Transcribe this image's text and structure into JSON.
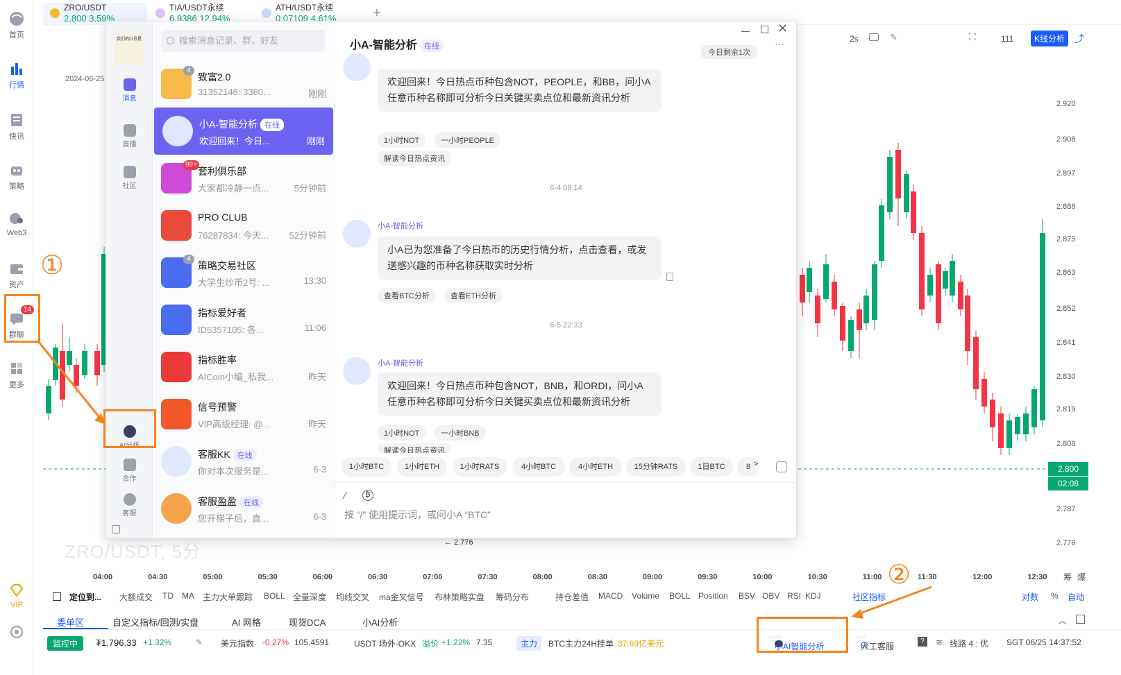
{
  "left_nav": {
    "items": [
      {
        "label": "首页",
        "icon": "globe-icon"
      },
      {
        "label": "行情",
        "icon": "bar-chart-icon"
      },
      {
        "label": "快讯",
        "icon": "news-icon"
      },
      {
        "label": "策略",
        "icon": "robot-icon"
      },
      {
        "label": "Web3",
        "icon": "web3-icon"
      },
      {
        "label": "资产",
        "icon": "wallet-icon"
      },
      {
        "label": "群聊",
        "icon": "chat-icon",
        "badge": "14"
      },
      {
        "label": "更多",
        "icon": "grid-icon"
      },
      {
        "label": "VIP",
        "icon": "vip-diamond-icon"
      }
    ]
  },
  "tabs": [
    {
      "name": "ZRO/USDT",
      "price": "2.800",
      "change": "3.59%"
    },
    {
      "name": "TIA/USDT永续",
      "price": "6.9386",
      "change": "12.94%"
    },
    {
      "name": "ATH/USDT永续",
      "price": "0.07109",
      "change": "4.61%"
    }
  ],
  "chart_toolbar": {
    "date": "2024-06-25",
    "interval": "2s",
    "cloud_count": "111",
    "kline_button": "K线分析"
  },
  "chart": {
    "watermark": "ZRO/USDT, 5分",
    "y_ticks": [
      "2.920",
      "2.908",
      "2.897",
      "2.886",
      "2.875",
      "2.863",
      "2.852",
      "2.841",
      "2.830",
      "2.819",
      "2.808",
      "2.787",
      "2.776"
    ],
    "current_price": "2.800",
    "countdown": "02:08",
    "low_label": "← 2.776",
    "x_ticks": [
      "04:00",
      "04:30",
      "05:00",
      "05:30",
      "06:00",
      "06:30",
      "07:00",
      "07:30",
      "08:00",
      "08:30",
      "09:00",
      "09:30",
      "10:00",
      "10:30",
      "11:00",
      "11:30",
      "12:00",
      "12:30"
    ],
    "corner_labels": [
      "筹",
      "爆"
    ]
  },
  "chat": {
    "rail": {
      "avatar_caption": "我们的口号是",
      "items": [
        "消息",
        "直播",
        "社区",
        "AI分析",
        "合作",
        "客服"
      ]
    },
    "search_placeholder": "搜索消息记录、群、好友",
    "conversations": [
      {
        "name": "致富2.0",
        "preview": "31352148: 3380...",
        "time": "刚刚",
        "badge": "4"
      },
      {
        "name": "小A-智能分析",
        "online": "在线",
        "preview": "欢迎回来！今日...",
        "time": "刚刚"
      },
      {
        "name": "套利俱乐部",
        "preview": "大家都冷静一点...",
        "time": "5分钟前",
        "badge": "99+"
      },
      {
        "name": "PRO CLUB",
        "preview": "76287834: 今天...",
        "time": "52分钟前"
      },
      {
        "name": "策略交易社区",
        "preview": "大学生炒币2号: ...",
        "time": "13:30",
        "badge": "4"
      },
      {
        "name": "指标爱好者",
        "preview": "ID5357105: 各...",
        "time": "11:06"
      },
      {
        "name": "指标胜率",
        "preview": "AICoin小编_私我...",
        "time": "昨天"
      },
      {
        "name": "信号预警",
        "preview": "VIP高级经理: @...",
        "time": "昨天"
      },
      {
        "name": "客服KK",
        "online": "在线",
        "preview": "你对本次服务是...",
        "time": "6-3"
      },
      {
        "name": "客服盈盈",
        "online": "在线",
        "preview": "您开梯子后，直...",
        "time": "6-3"
      }
    ],
    "main": {
      "title": "小A-智能分析",
      "status": "在线",
      "remaining": "今日剩余1次",
      "sender": "小A-智能分析",
      "messages": [
        {
          "text": "欢迎回来！今日热点币种包含NOT，PEOPLE，和BB，问小A任意币种名称即可分析今日关键买卖点位和最新资讯分析",
          "chips": [
            "1小时NOT",
            "一小时PEOPLE",
            "解读今日热点资讯"
          ]
        },
        {
          "time": "6-4 09:14",
          "text": "小A已为您准备了今日热币的历史行情分析，点击查看，或发送感兴趣的币种名称获取实时分析",
          "chips": [
            "查看BTC分析",
            "查看ETH分析"
          ]
        },
        {
          "time": "6-5 22:33",
          "text": "欢迎回来！今日热点币种包含NOT，BNB，和ORDI，问小A任意币种名称即可分析今日关键买卖点位和最新资讯分析",
          "chips": [
            "1小时NOT",
            "一小时BNB",
            "解读今日热点资讯"
          ]
        }
      ],
      "quick_buttons": [
        "1小时BTC",
        "1小时ETH",
        "1小时RATS",
        "4小时BTC",
        "4小时ETH",
        "15分钟RATS",
        "1日BTC",
        "8"
      ],
      "input_placeholder": "按 “/” 使用提示词，或问小A “BTC”"
    }
  },
  "indicator_bar": [
    "定位到...",
    "大额成交",
    "TD",
    "MA",
    "主力大单跟踪",
    "BOLL",
    "全量深度",
    "均线交叉",
    "ma金叉信号",
    "布林策略实盘",
    "筹码分布",
    "持仓差值",
    "MACD",
    "Volume",
    "BOLL",
    "Position",
    "BSV",
    "OBV",
    "RSI",
    "KDJ",
    "社区指标",
    "对数",
    "%",
    "自动"
  ],
  "panel_tabs": [
    "委单区",
    "自定义指标/回测/实盘",
    "AI 网格",
    "现货DCA",
    "小AI分析"
  ],
  "status_bar": {
    "monitor": "监控中",
    "btc_price": "₮1,796.33",
    "btc_change": "+1.32%",
    "usd_index_label": "美元指数",
    "usd_index_change": "-0.27%",
    "usd_index_value": "105.4591",
    "usdt_label": "USDT 场外-OKX",
    "premium_label": "溢价",
    "premium_value": "+1.22%",
    "usdt_value": "7.35",
    "main_force": "主力",
    "btc_24h": "BTC主力24H挂单",
    "btc_24h_value": "37.69亿美元",
    "ai_button": "小AI智能分析",
    "service": "人工客服",
    "line": "线路 4 : 优",
    "clock": "SGT 06/25 14:37:52"
  },
  "callouts": [
    "①",
    "②"
  ],
  "colors": {
    "accent": "#1a5cff",
    "purple": "#6d63f1",
    "up": "#06a870",
    "down": "#f23645",
    "callout": "#f5841f"
  }
}
